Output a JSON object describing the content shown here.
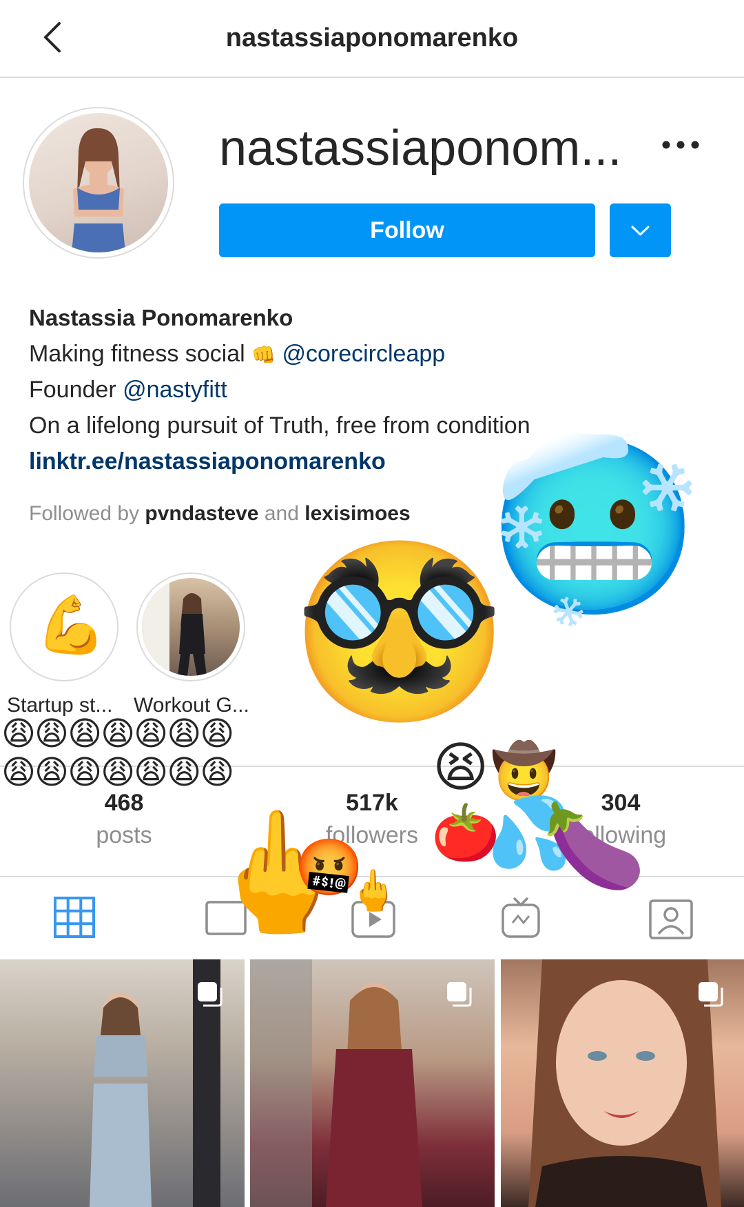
{
  "header": {
    "title": "nastassiaponomarenko"
  },
  "profile": {
    "username_display": "nastassiaponom...",
    "follow_label": "Follow",
    "full_name": "Nastassia Ponomarenko",
    "bio_line1_text": "Making fitness social",
    "bio_line1_emoji": "👊",
    "bio_line1_mention": "@corecircleapp",
    "bio_line2_text": "Founder",
    "bio_line2_mention": "@nastyfitt",
    "bio_line3": "On a lifelong pursuit of Truth, free from condition",
    "link": "linktr.ee/nastassiaponomarenko",
    "followed_by_prefix": "Followed by",
    "followed_by_user1": "pvndasteve",
    "followed_by_and": "and",
    "followed_by_user2": "lexisimoes"
  },
  "highlights": [
    {
      "label": "Startup st...",
      "cover_emoji": "💪"
    },
    {
      "label": "Workout G..."
    }
  ],
  "stats": {
    "posts": {
      "value": "468",
      "label": "posts"
    },
    "followers": {
      "value": "517k",
      "label": "followers"
    },
    "following": {
      "value": "304",
      "label": "following"
    }
  },
  "tabs": [
    "grid-icon",
    "reels-icon",
    "video-icon",
    "igtv-icon",
    "tagged-icon"
  ],
  "stickers": {
    "cold_face": "🥶",
    "disguise": "🥸",
    "weary_row": "😩😩😩😩😩😩😩",
    "tired": "😫",
    "cowboy": "🤠",
    "tomato": "🍅",
    "sweat": "💦",
    "eggplant": "🍆",
    "middle_finger_large": "🖕",
    "middle_finger_small": "🖕",
    "cursing": "🤬"
  },
  "colors": {
    "accent": "#0095f6",
    "link": "#00376b",
    "muted": "#8e8e8e",
    "border": "#dbdbdb"
  }
}
